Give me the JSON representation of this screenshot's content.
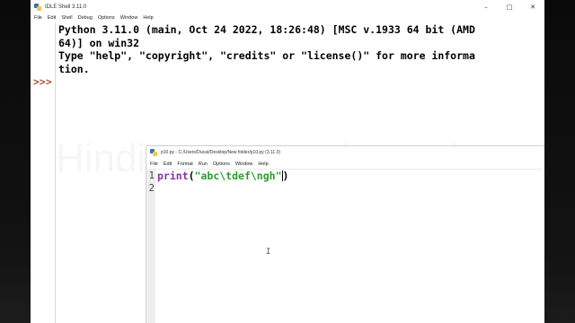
{
  "shell": {
    "title": "IDLE Shell 3.11.0",
    "menu": [
      "File",
      "Edit",
      "Shell",
      "Debug",
      "Options",
      "Window",
      "Help"
    ],
    "window_controls": {
      "minimize": "–",
      "maximize": "□",
      "close": "✕"
    },
    "lines": [
      "Python 3.11.0 (main, Oct 24 2022, 18:26:48) [MSC v.1933 64 bit (AMD",
      "64)] on win32",
      "Type \"help\", \"copyright\", \"credits\" or \"license()\" for more informa",
      "tion."
    ],
    "prompt": ">>>",
    "watermark": "Hindi Programming point"
  },
  "editor": {
    "title": "p10.py - C:/Users/Ducat/Desktop/New folder/p10.py (3.11.0)",
    "menu": [
      "File",
      "Edit",
      "Format",
      "Run",
      "Options",
      "Window",
      "Help"
    ],
    "line_numbers": [
      "1",
      "2"
    ],
    "code": {
      "keyword": "print",
      "open_paren": "(",
      "string": "\"abc\\tdef\\ngh\"",
      "close_paren": ")"
    },
    "mouse_cursor": "I"
  },
  "colors": {
    "keyword": "#8b2fa8",
    "string": "#2b9d2b",
    "prompt": "#a0522d"
  }
}
